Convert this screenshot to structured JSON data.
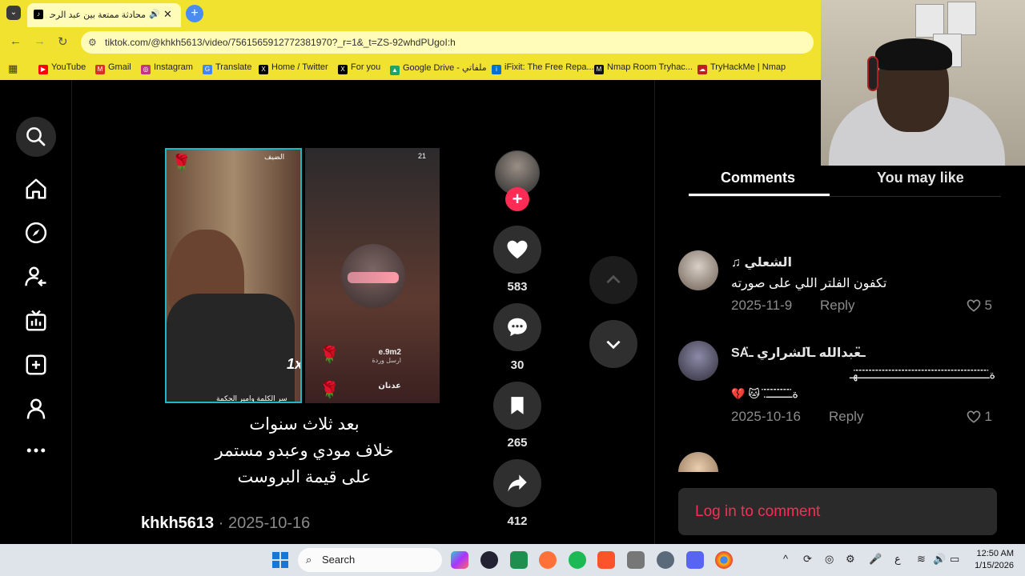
{
  "browser": {
    "tab_title": "محادثة ممتعة بين عبد الرحمن",
    "address": "tiktok.com/@khkh5613/video/7561565912772381970?_r=1&_t=ZS-92whdPUgoI:h",
    "bookmarks": [
      {
        "label": "YouTube",
        "color": "#ff0000"
      },
      {
        "label": "Gmail",
        "color": "#d93025"
      },
      {
        "label": "Instagram",
        "color": "#c13584"
      },
      {
        "label": "Translate",
        "color": "#4285f4"
      },
      {
        "label": "Home / Twitter",
        "color": "#000000"
      },
      {
        "label": "For you",
        "color": "#000000"
      },
      {
        "label": "Google Drive - ملفاتي",
        "color": "#1fa463"
      },
      {
        "label": "iFixit: The Free Repa...",
        "color": "#0071ce"
      },
      {
        "label": "Nmap Room Tryhac...",
        "color": "#111111"
      },
      {
        "label": "TryHackMe | Nmap",
        "color": "#c11e1e"
      }
    ]
  },
  "video": {
    "guest_label": "الضيف",
    "viewer_count": "21",
    "gift_user": "e.9m2",
    "gift_text": "ارسل وردة",
    "chat_user": "عدنان",
    "bottom_label": "سر الكلمة وامير الحكمة",
    "multiplier": "1x",
    "caption_lines": [
      "بعد ثلاث سنوات",
      "خلاف مودي وعبدو مستمر",
      "على قيمة البروست"
    ],
    "author": "khkh5613",
    "date": "· 2025-10-16"
  },
  "actions": {
    "likes": "583",
    "comments": "30",
    "saves": "265",
    "shares": "412"
  },
  "panel": {
    "tab_comments": "Comments",
    "tab_may_like": "You may like",
    "comments": [
      {
        "name": "الشعلي ♫",
        "text": "تكفون الفلتر اللي على صورته",
        "date": "2025-11-9",
        "reply": "Reply",
        "likes": "5"
      },
      {
        "name": "ـ̈عبدالله ـ̈الشراري ـ̈SA",
        "text": "ة̈ـ̈ـ̈ـ̈ـ̈ـ̈ـ̈ـ̈ـ̈ـ̈ـ̈ـ̈ـ̈ـ̈ـ̈ـ̈ـ̈ـ̈ـ̈ـ̈ـ̈ـ̈ـ̈ـ̈ـ̈ـ̈ـ̈ـ̈ـ̈ـ̈ـ̈ـ̈ـ̈ـ̈ـ̈ـ̈ـ̈ـ̈ـ̈ـ̈ـ̈هـ",
        "text2": "ة̈ـ̈ـ̈ـ̈ـ̈ـ̈ـ̈ـ̈ـ̈. 🐱 💔",
        "date": "2025-10-16",
        "reply": "Reply",
        "likes": "1"
      }
    ],
    "login": "Log in to comment"
  },
  "taskbar": {
    "search": "Search",
    "time": "12:50 AM",
    "date": "1/15/2026",
    "lang": "ع"
  }
}
